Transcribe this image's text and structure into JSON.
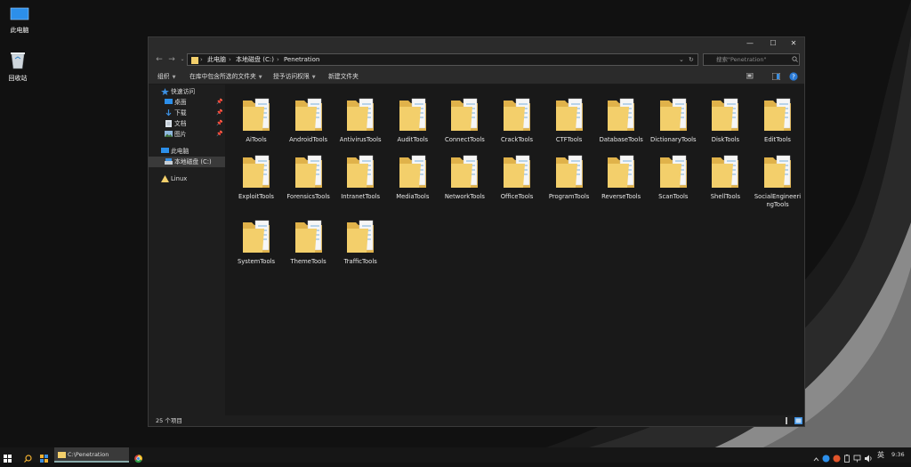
{
  "desktop": {
    "icons": [
      {
        "label": "此电脑",
        "icon": "computer-icon"
      },
      {
        "label": "回收站",
        "icon": "recycle-bin-icon"
      }
    ]
  },
  "window": {
    "caption": {
      "minimize": "—",
      "maximize": "☐",
      "close": "✕"
    },
    "nav": {
      "back": "←",
      "forward": "→",
      "up_history": "⌄",
      "up": "↑",
      "refresh": "↻"
    },
    "breadcrumb": [
      "此电脑",
      "本地磁盘 (C:)",
      "Penetration"
    ],
    "search_placeholder": "搜索\"Penetration\"",
    "ribbon": {
      "organize": "组织",
      "include_library": "在库中包含所选的文件夹",
      "share_with": "授予访问权限",
      "new_folder": "新建文件夹"
    },
    "nav_pane": {
      "quick_access": "快速访问",
      "items": [
        {
          "label": "桌面",
          "icon": "desktop-icon",
          "pinned": true
        },
        {
          "label": "下载",
          "icon": "download-icon",
          "pinned": true
        },
        {
          "label": "文档",
          "icon": "document-icon",
          "pinned": true
        },
        {
          "label": "图片",
          "icon": "picture-icon",
          "pinned": true
        }
      ],
      "this_pc": "此电脑",
      "local_disk": "本地磁盘 (C:)",
      "linux": "Linux"
    },
    "folders": [
      {
        "name": "AiTools"
      },
      {
        "name": "AndroidTools"
      },
      {
        "name": "AntivirusTools"
      },
      {
        "name": "AuditTools"
      },
      {
        "name": "ConnectTools"
      },
      {
        "name": "CrackTools"
      },
      {
        "name": "CTFTools"
      },
      {
        "name": "DatabaseTools"
      },
      {
        "name": "DictionaryTools"
      },
      {
        "name": "DiskTools"
      },
      {
        "name": "EditTools"
      },
      {
        "name": "ExploitTools"
      },
      {
        "name": "ForensicsTools"
      },
      {
        "name": "IntranetTools"
      },
      {
        "name": "MediaTools"
      },
      {
        "name": "NetworkTools"
      },
      {
        "name": "OfficeTools"
      },
      {
        "name": "ProgramTools"
      },
      {
        "name": "ReverseTools"
      },
      {
        "name": "ScanTools"
      },
      {
        "name": "ShellTools"
      },
      {
        "name": "SocialEngineeringTools",
        "label_line1": "SocialEngineeri",
        "label_line2": "ngTools"
      },
      {
        "name": "SystemTools"
      },
      {
        "name": "ThemeTools"
      },
      {
        "name": "TrafficTools"
      }
    ],
    "status": {
      "item_count": "25 个项目"
    }
  },
  "taskbar": {
    "active_window": "C:\\Penetration",
    "tray": {
      "ime": "英",
      "time": "9:36"
    }
  },
  "colors": {
    "folder_yellow": "#f3cf6b",
    "folder_dark": "#e0b24a",
    "accent_blue": "#2f8fe6"
  }
}
